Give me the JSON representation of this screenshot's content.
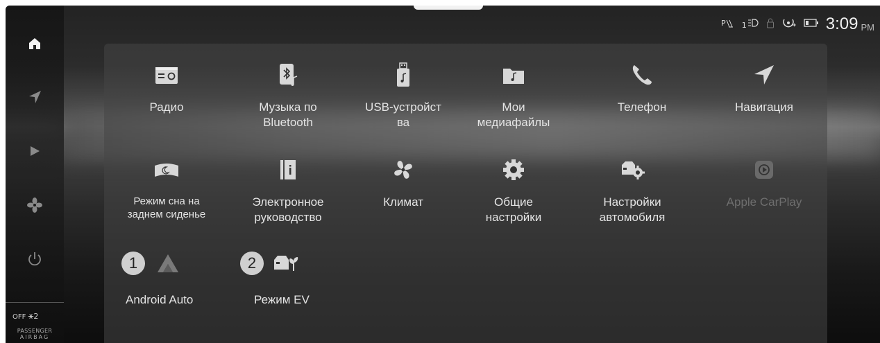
{
  "status_bar": {
    "time": "3:09",
    "ampm": "PM",
    "icons": [
      "autohold-icon",
      "cruise-icon",
      "lock-icon",
      "tpms-icon",
      "battery-icon"
    ],
    "gear_indicator": "1"
  },
  "sidebar": {
    "items": [
      {
        "name": "home",
        "icon": "home-icon",
        "active": true
      },
      {
        "name": "navigation",
        "icon": "navigation-arrow-icon"
      },
      {
        "name": "media",
        "icon": "play-icon"
      },
      {
        "name": "climate",
        "icon": "fan-icon"
      },
      {
        "name": "power",
        "icon": "power-icon"
      }
    ],
    "airbag": {
      "state": "OFF",
      "seat_number": "2",
      "label_line1": "PASSENGER",
      "label_line2": "AIRBAG"
    }
  },
  "apps": [
    {
      "label": "Радио",
      "icon": "radio-icon"
    },
    {
      "label": "Музыка по Bluetooth",
      "label_line1": "Музыка по",
      "label_line2": "Bluetooth",
      "icon": "bluetooth-music-icon"
    },
    {
      "label_line1": "USB-устройст",
      "label_line2": "ва",
      "icon": "usb-icon"
    },
    {
      "label_line1": "Мои",
      "label_line2": "медиафайлы",
      "icon": "media-folder-icon"
    },
    {
      "label": "Телефон",
      "icon": "phone-icon"
    },
    {
      "label": "Навигация",
      "icon": "navigation-icon"
    },
    {
      "label_line1": "Режим сна на",
      "label_line2": "заднем сиденье",
      "icon": "rear-sleep-mode-icon"
    },
    {
      "label_line1": "Электронное",
      "label_line2": "руководство",
      "icon": "manual-icon"
    },
    {
      "label": "Климат",
      "icon": "climate-fan-icon"
    },
    {
      "label_line1": "Общие",
      "label_line2": "настройки",
      "icon": "settings-gear-icon"
    },
    {
      "label_line1": "Настройки",
      "label_line2": "автомобиля",
      "icon": "vehicle-settings-icon"
    },
    {
      "label": "Apple CarPlay",
      "icon": "carplay-icon",
      "disabled": true
    }
  ],
  "bottom_apps": [
    {
      "badge": "1",
      "label": "Android Auto",
      "icon": "android-auto-icon"
    },
    {
      "badge": "2",
      "label": "Режим EV",
      "icon": "ev-mode-icon"
    }
  ]
}
